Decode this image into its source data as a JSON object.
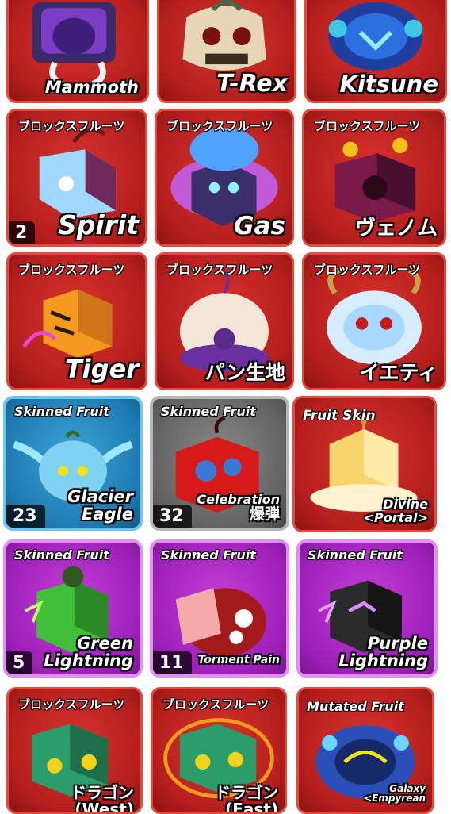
{
  "rows": [
    {
      "cards": [
        {
          "theme": "red",
          "tag": "",
          "name_lines": [
            "Mammoth"
          ],
          "count": "",
          "icon": "mammoth-fruit-icon",
          "art_color": "#7b3cc6"
        },
        {
          "theme": "red",
          "tag": "",
          "name_lines": [
            "T-Rex"
          ],
          "count": "",
          "icon": "trex-fruit-icon",
          "art_color": "#e6d6b4"
        },
        {
          "theme": "red",
          "tag": "",
          "name_lines": [
            "Kitsune"
          ],
          "count": "",
          "icon": "kitsune-fruit-icon",
          "art_color": "#2e6fe0"
        }
      ]
    },
    {
      "cards": [
        {
          "theme": "red",
          "tag": "ブロックスフルーツ",
          "name_lines": [
            "Spirit"
          ],
          "count": "2",
          "icon": "spirit-fruit-icon",
          "art_color": "#9fd7ff"
        },
        {
          "theme": "red",
          "tag": "ブロックスフルーツ",
          "name_lines": [
            "Gas"
          ],
          "count": "",
          "icon": "gas-fruit-icon",
          "art_color": "#5a3fb0"
        },
        {
          "theme": "red",
          "tag": "ブロックスフルーツ",
          "name_lines": [
            "ヴェノム"
          ],
          "count": "",
          "icon": "venom-fruit-icon",
          "art_color": "#7a1a4a"
        }
      ]
    },
    {
      "cards": [
        {
          "theme": "red",
          "tag": "ブロックスフルーツ",
          "name_lines": [
            "Tiger"
          ],
          "count": "",
          "icon": "tiger-fruit-icon",
          "art_color": "#f39a1f"
        },
        {
          "theme": "red",
          "tag": "ブロックスフルーツ",
          "name_lines": [
            "パン生地"
          ],
          "count": "",
          "icon": "dough-fruit-icon",
          "art_color": "#f4e6d6"
        },
        {
          "theme": "red",
          "tag": "ブロックスフルーツ",
          "name_lines": [
            "イエティ"
          ],
          "count": "",
          "icon": "yeti-fruit-icon",
          "art_color": "#d6ecff"
        }
      ]
    },
    {
      "cards": [
        {
          "theme": "blue",
          "tag": "Skinned Fruit",
          "name_lines": [
            "Glacier",
            "Eagle"
          ],
          "count": "23",
          "icon": "glacier-eagle-fruit-icon",
          "art_color": "#7fd2f2"
        },
        {
          "theme": "gray",
          "tag": "Skinned Fruit",
          "name_lines": [
            "Celebration",
            "爆弾"
          ],
          "count": "32",
          "icon": "celebration-bomb-fruit-icon",
          "art_color": "#d61a1a"
        },
        {
          "theme": "redlight",
          "tag": "Fruit Skin",
          "name_lines": [
            "Divine",
            "<Portal>"
          ],
          "count": "",
          "icon": "divine-portal-fruit-icon",
          "art_color": "#f6d46a"
        }
      ]
    },
    {
      "cards": [
        {
          "theme": "purple",
          "tag": "Skinned Fruit",
          "name_lines": [
            "Green",
            "Lightning"
          ],
          "count": "5",
          "icon": "green-lightning-fruit-icon",
          "art_color": "#3fbf3a"
        },
        {
          "theme": "purple",
          "tag": "Skinned Fruit",
          "name_lines": [
            "Torment Pain"
          ],
          "count": "11",
          "icon": "torment-pain-fruit-icon",
          "art_color": "#f3a9a9"
        },
        {
          "theme": "purple",
          "tag": "Skinned Fruit",
          "name_lines": [
            "Purple",
            "Lightning"
          ],
          "count": "",
          "icon": "purple-lightning-fruit-icon",
          "art_color": "#2b2b2b"
        }
      ]
    },
    {
      "cards": [
        {
          "theme": "red",
          "tag": "ブロックスフルーツ",
          "name_lines": [
            "ドラゴン",
            "(West)"
          ],
          "count": "",
          "icon": "dragon-west-fruit-icon",
          "art_color": "#2a9d6a"
        },
        {
          "theme": "red",
          "tag": "ブロックスフルーツ",
          "name_lines": [
            "ドラゴン",
            "(East)"
          ],
          "count": "",
          "icon": "dragon-east-fruit-icon",
          "art_color": "#2a9d6a"
        },
        {
          "theme": "red",
          "tag": "Mutated Fruit",
          "name_lines": [
            "Galaxy",
            "<Empyrean"
          ],
          "count": "",
          "icon": "galaxy-empyrean-fruit-icon",
          "art_color": "#2b4fb8"
        }
      ]
    }
  ]
}
